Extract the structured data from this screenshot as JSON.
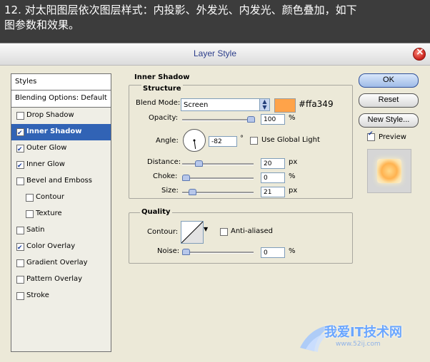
{
  "banner": {
    "line1": "12. 对太阳图层依次图层样式：内投影、外发光、内发光、颜色叠加，如下",
    "line2": "图参数和效果。"
  },
  "dialog": {
    "title": "Layer Style",
    "styles_header": "Styles",
    "blending_options": "Blending Options: Default",
    "style_items": [
      {
        "label": "Drop Shadow",
        "checked": false,
        "selected": false,
        "indent": false
      },
      {
        "label": "Inner Shadow",
        "checked": true,
        "selected": true,
        "indent": false
      },
      {
        "label": "Outer Glow",
        "checked": true,
        "selected": false,
        "indent": false
      },
      {
        "label": "Inner Glow",
        "checked": true,
        "selected": false,
        "indent": false
      },
      {
        "label": "Bevel and Emboss",
        "checked": false,
        "selected": false,
        "indent": false
      },
      {
        "label": "Contour",
        "checked": false,
        "selected": false,
        "indent": true
      },
      {
        "label": "Texture",
        "checked": false,
        "selected": false,
        "indent": true
      },
      {
        "label": "Satin",
        "checked": false,
        "selected": false,
        "indent": false
      },
      {
        "label": "Color Overlay",
        "checked": true,
        "selected": false,
        "indent": false
      },
      {
        "label": "Gradient Overlay",
        "checked": false,
        "selected": false,
        "indent": false
      },
      {
        "label": "Pattern Overlay",
        "checked": false,
        "selected": false,
        "indent": false
      },
      {
        "label": "Stroke",
        "checked": false,
        "selected": false,
        "indent": false
      }
    ]
  },
  "inner_shadow": {
    "heading": "Inner Shadow",
    "structure_heading": "Structure",
    "blend_mode_label": "Blend Mode:",
    "blend_mode_value": "Screen",
    "color_hex_label": "#ffa349",
    "color": "#ffa349",
    "opacity_label": "Opacity:",
    "opacity_value": "100",
    "opacity_unit": "%",
    "opacity_level": 1.0,
    "angle_label": "Angle:",
    "angle_value": "-82",
    "angle_unit": "°",
    "use_global_light_label": "Use Global Light",
    "use_global_light_checked": false,
    "distance_label": "Distance:",
    "distance_value": "20",
    "distance_unit": "px",
    "distance_level": 0.2,
    "choke_label": "Choke:",
    "choke_value": "0",
    "choke_unit": "%",
    "choke_level": 0.0,
    "size_label": "Size:",
    "size_value": "21",
    "size_unit": "px",
    "size_level": 0.1
  },
  "quality": {
    "heading": "Quality",
    "contour_label": "Contour:",
    "anti_aliased_label": "Anti-aliased",
    "anti_aliased_checked": false,
    "noise_label": "Noise:",
    "noise_value": "0",
    "noise_unit": "%",
    "noise_level": 0.0
  },
  "buttons": {
    "ok": "OK",
    "reset": "Reset",
    "new_style": "New Style...",
    "preview_label": "Preview",
    "preview_checked": true
  },
  "watermark": {
    "text": "我爱IT技术网",
    "url": "www.52ij.com"
  },
  "colors": {
    "selection": "#3163b5",
    "accent": "#ffa349",
    "dialog_bg": "#ece9d8"
  }
}
